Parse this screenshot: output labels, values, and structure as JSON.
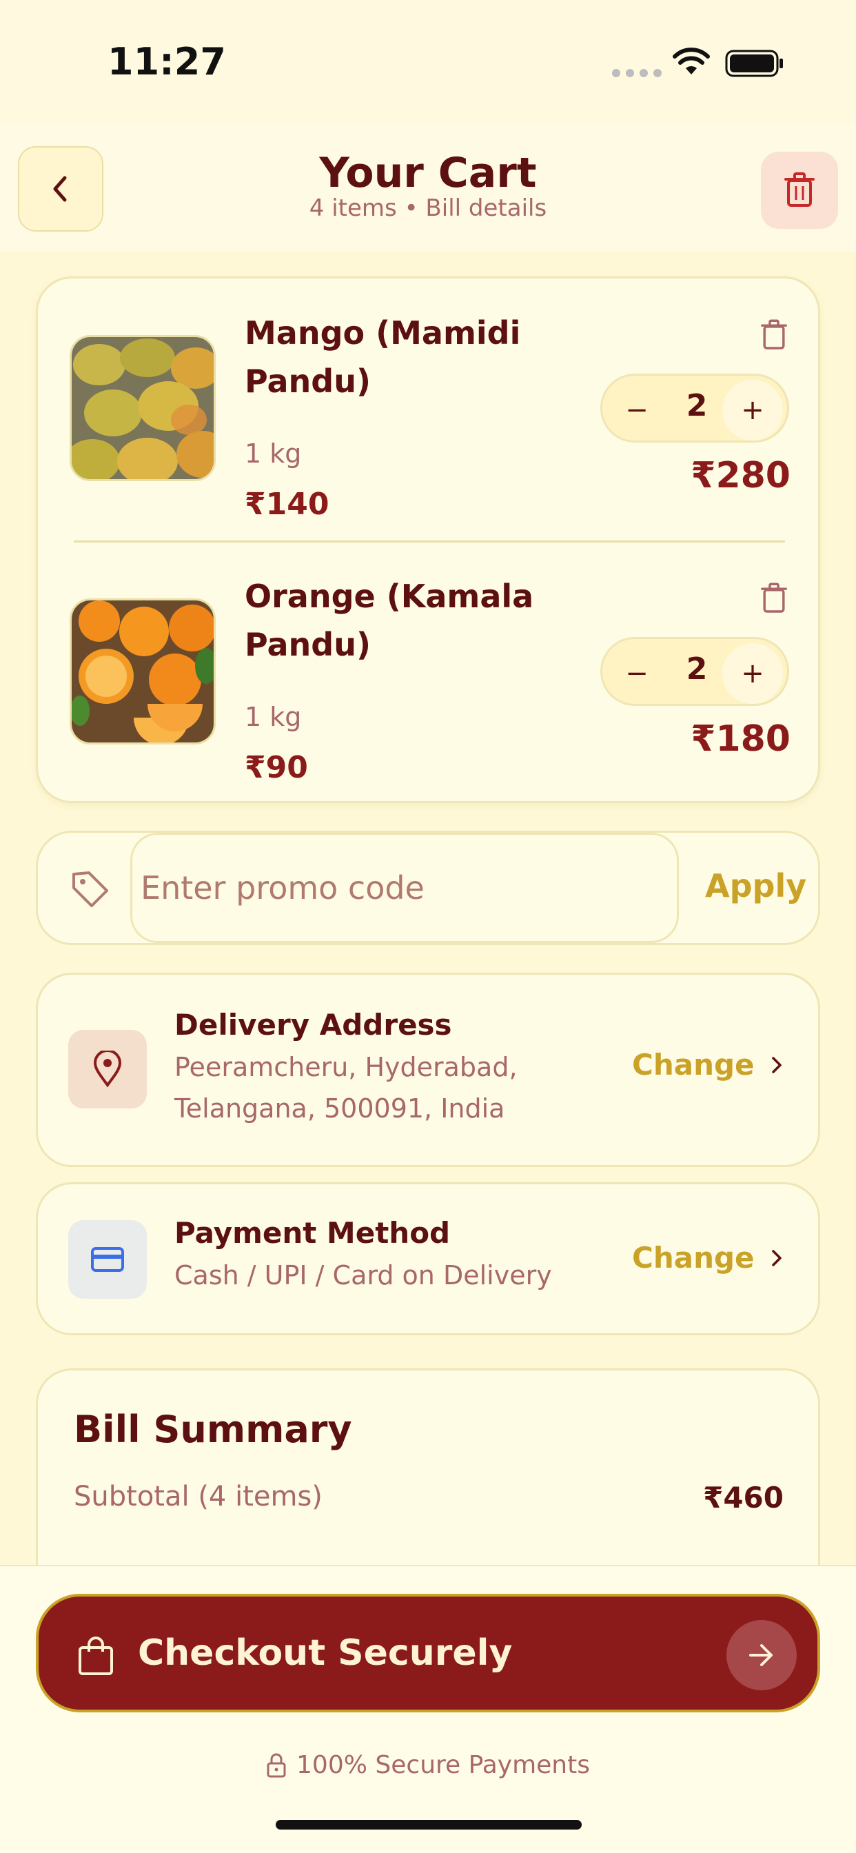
{
  "status_bar": {
    "time": "11:27"
  },
  "header": {
    "title": "Your Cart",
    "subtitle": "4 items • Bill details"
  },
  "cart": {
    "items": [
      {
        "name": "Mango (Mamidi Pandu)",
        "unit": "1 kg",
        "price": "₹140",
        "quantity": "2",
        "total": "₹280",
        "decrement": "−",
        "increment": "+"
      },
      {
        "name": "Orange (Kamala Pandu)",
        "unit": "1 kg",
        "price": "₹90",
        "quantity": "2",
        "total": "₹180",
        "decrement": "−",
        "increment": "+"
      }
    ]
  },
  "promo": {
    "placeholder": "Enter promo code",
    "apply_label": "Apply"
  },
  "delivery": {
    "title": "Delivery Address",
    "line1": "Peeramcheru, Hyderabad,",
    "line2": "Telangana, 500091, India",
    "change_label": "Change"
  },
  "payment": {
    "title": "Payment Method",
    "subtitle": "Cash / UPI / Card on Delivery",
    "change_label": "Change"
  },
  "bill": {
    "title": "Bill Summary",
    "subtotal_label": "Subtotal (4 items)",
    "subtotal_value": "₹460"
  },
  "checkout": {
    "label": "Checkout Securely",
    "secure_note": "100% Secure Payments"
  },
  "colors": {
    "primary": "#8B1A1A",
    "accent": "#C9A227",
    "background": "#FFF8D6"
  }
}
